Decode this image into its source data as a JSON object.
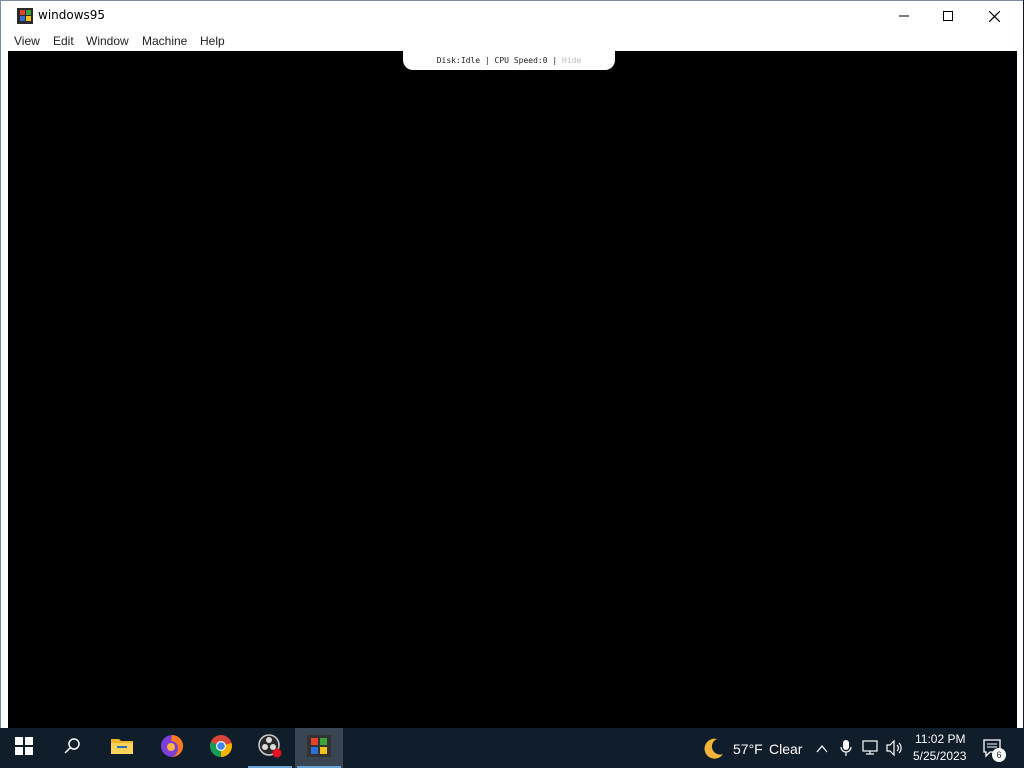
{
  "window": {
    "title": "windows95",
    "controls": {
      "minimize": "minimize-icon",
      "maximize": "maximize-icon",
      "close": "close-icon"
    }
  },
  "menu": {
    "items": [
      "View",
      "Edit",
      "Window",
      "Machine",
      "Help"
    ]
  },
  "status": {
    "disk_label": "Disk:",
    "disk_value": "Idle",
    "cpu_label": "CPU Speed:",
    "cpu_value": "0",
    "hide_label": "Hide"
  },
  "taskbar": {
    "icons": [
      "windows-start-icon",
      "search-icon",
      "file-explorer-icon",
      "firefox-icon",
      "chrome-icon",
      "obs-icon",
      "windows95-app-icon"
    ],
    "weather": {
      "temp": "57°F",
      "condition": "Clear",
      "icon": "moon-icon"
    },
    "clock": {
      "time": "11:02 PM",
      "date": "5/25/2023"
    },
    "notifications_count": "6"
  },
  "colors": {
    "taskbar_bg": "#101d2b",
    "active_app_bg": "#3a4553",
    "underline": "#6aa3d8",
    "screen_bg": "#000000"
  }
}
